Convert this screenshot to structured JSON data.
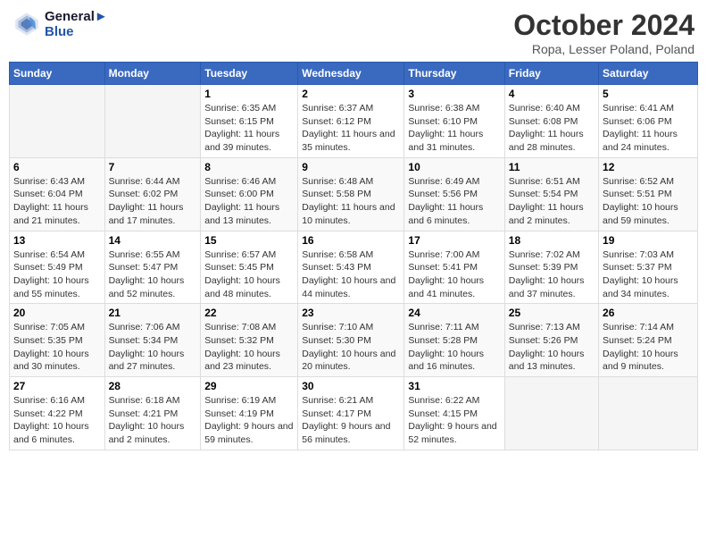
{
  "header": {
    "logo_line1": "General",
    "logo_line2": "Blue",
    "month": "October 2024",
    "location": "Ropa, Lesser Poland, Poland"
  },
  "days_of_week": [
    "Sunday",
    "Monday",
    "Tuesday",
    "Wednesday",
    "Thursday",
    "Friday",
    "Saturday"
  ],
  "weeks": [
    [
      {
        "day": "",
        "info": ""
      },
      {
        "day": "",
        "info": ""
      },
      {
        "day": "1",
        "info": "Sunrise: 6:35 AM\nSunset: 6:15 PM\nDaylight: 11 hours and 39 minutes."
      },
      {
        "day": "2",
        "info": "Sunrise: 6:37 AM\nSunset: 6:12 PM\nDaylight: 11 hours and 35 minutes."
      },
      {
        "day": "3",
        "info": "Sunrise: 6:38 AM\nSunset: 6:10 PM\nDaylight: 11 hours and 31 minutes."
      },
      {
        "day": "4",
        "info": "Sunrise: 6:40 AM\nSunset: 6:08 PM\nDaylight: 11 hours and 28 minutes."
      },
      {
        "day": "5",
        "info": "Sunrise: 6:41 AM\nSunset: 6:06 PM\nDaylight: 11 hours and 24 minutes."
      }
    ],
    [
      {
        "day": "6",
        "info": "Sunrise: 6:43 AM\nSunset: 6:04 PM\nDaylight: 11 hours and 21 minutes."
      },
      {
        "day": "7",
        "info": "Sunrise: 6:44 AM\nSunset: 6:02 PM\nDaylight: 11 hours and 17 minutes."
      },
      {
        "day": "8",
        "info": "Sunrise: 6:46 AM\nSunset: 6:00 PM\nDaylight: 11 hours and 13 minutes."
      },
      {
        "day": "9",
        "info": "Sunrise: 6:48 AM\nSunset: 5:58 PM\nDaylight: 11 hours and 10 minutes."
      },
      {
        "day": "10",
        "info": "Sunrise: 6:49 AM\nSunset: 5:56 PM\nDaylight: 11 hours and 6 minutes."
      },
      {
        "day": "11",
        "info": "Sunrise: 6:51 AM\nSunset: 5:54 PM\nDaylight: 11 hours and 2 minutes."
      },
      {
        "day": "12",
        "info": "Sunrise: 6:52 AM\nSunset: 5:51 PM\nDaylight: 10 hours and 59 minutes."
      }
    ],
    [
      {
        "day": "13",
        "info": "Sunrise: 6:54 AM\nSunset: 5:49 PM\nDaylight: 10 hours and 55 minutes."
      },
      {
        "day": "14",
        "info": "Sunrise: 6:55 AM\nSunset: 5:47 PM\nDaylight: 10 hours and 52 minutes."
      },
      {
        "day": "15",
        "info": "Sunrise: 6:57 AM\nSunset: 5:45 PM\nDaylight: 10 hours and 48 minutes."
      },
      {
        "day": "16",
        "info": "Sunrise: 6:58 AM\nSunset: 5:43 PM\nDaylight: 10 hours and 44 minutes."
      },
      {
        "day": "17",
        "info": "Sunrise: 7:00 AM\nSunset: 5:41 PM\nDaylight: 10 hours and 41 minutes."
      },
      {
        "day": "18",
        "info": "Sunrise: 7:02 AM\nSunset: 5:39 PM\nDaylight: 10 hours and 37 minutes."
      },
      {
        "day": "19",
        "info": "Sunrise: 7:03 AM\nSunset: 5:37 PM\nDaylight: 10 hours and 34 minutes."
      }
    ],
    [
      {
        "day": "20",
        "info": "Sunrise: 7:05 AM\nSunset: 5:35 PM\nDaylight: 10 hours and 30 minutes."
      },
      {
        "day": "21",
        "info": "Sunrise: 7:06 AM\nSunset: 5:34 PM\nDaylight: 10 hours and 27 minutes."
      },
      {
        "day": "22",
        "info": "Sunrise: 7:08 AM\nSunset: 5:32 PM\nDaylight: 10 hours and 23 minutes."
      },
      {
        "day": "23",
        "info": "Sunrise: 7:10 AM\nSunset: 5:30 PM\nDaylight: 10 hours and 20 minutes."
      },
      {
        "day": "24",
        "info": "Sunrise: 7:11 AM\nSunset: 5:28 PM\nDaylight: 10 hours and 16 minutes."
      },
      {
        "day": "25",
        "info": "Sunrise: 7:13 AM\nSunset: 5:26 PM\nDaylight: 10 hours and 13 minutes."
      },
      {
        "day": "26",
        "info": "Sunrise: 7:14 AM\nSunset: 5:24 PM\nDaylight: 10 hours and 9 minutes."
      }
    ],
    [
      {
        "day": "27",
        "info": "Sunrise: 6:16 AM\nSunset: 4:22 PM\nDaylight: 10 hours and 6 minutes."
      },
      {
        "day": "28",
        "info": "Sunrise: 6:18 AM\nSunset: 4:21 PM\nDaylight: 10 hours and 2 minutes."
      },
      {
        "day": "29",
        "info": "Sunrise: 6:19 AM\nSunset: 4:19 PM\nDaylight: 9 hours and 59 minutes."
      },
      {
        "day": "30",
        "info": "Sunrise: 6:21 AM\nSunset: 4:17 PM\nDaylight: 9 hours and 56 minutes."
      },
      {
        "day": "31",
        "info": "Sunrise: 6:22 AM\nSunset: 4:15 PM\nDaylight: 9 hours and 52 minutes."
      },
      {
        "day": "",
        "info": ""
      },
      {
        "day": "",
        "info": ""
      }
    ]
  ]
}
